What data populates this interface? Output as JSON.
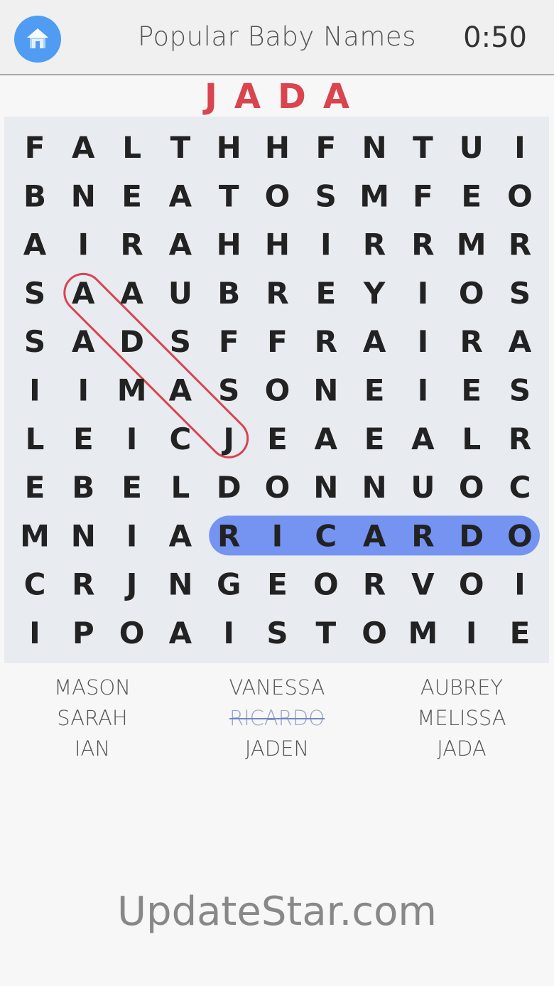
{
  "header": {
    "title": "Popular Baby Names",
    "timer": "0:50"
  },
  "current_word": "JADA",
  "grid": [
    [
      "F",
      "A",
      "L",
      "T",
      "H",
      "H",
      "F",
      "N",
      "T",
      "U",
      "I"
    ],
    [
      "B",
      "N",
      "E",
      "A",
      "T",
      "O",
      "S",
      "M",
      "F",
      "E",
      "O"
    ],
    [
      "A",
      "I",
      "R",
      "A",
      "H",
      "H",
      "I",
      "R",
      "R",
      "M",
      "R"
    ],
    [
      "S",
      "A",
      "A",
      "U",
      "B",
      "R",
      "E",
      "Y",
      "I",
      "O",
      "S"
    ],
    [
      "S",
      "A",
      "D",
      "S",
      "F",
      "F",
      "R",
      "A",
      "I",
      "R",
      "A"
    ],
    [
      "I",
      "I",
      "M",
      "A",
      "S",
      "O",
      "N",
      "E",
      "I",
      "E",
      "S"
    ],
    [
      "L",
      "E",
      "I",
      "C",
      "J",
      "E",
      "A",
      "E",
      "A",
      "L",
      "R"
    ],
    [
      "E",
      "B",
      "E",
      "L",
      "D",
      "O",
      "N",
      "N",
      "U",
      "O",
      "C"
    ],
    [
      "M",
      "N",
      "I",
      "A",
      "R",
      "I",
      "C",
      "A",
      "R",
      "D",
      "O"
    ],
    [
      "C",
      "R",
      "J",
      "N",
      "G",
      "E",
      "O",
      "R",
      "V",
      "O",
      "I"
    ],
    [
      "I",
      "P",
      "O",
      "A",
      "I",
      "S",
      "T",
      "O",
      "M",
      "I",
      "E"
    ]
  ],
  "selections": {
    "found": [
      {
        "word": "RICARDO",
        "start": [
          8,
          4
        ],
        "end": [
          8,
          10
        ],
        "color": "#6f8ff0"
      }
    ],
    "active": {
      "word": "JADA",
      "start": [
        3,
        1
      ],
      "end": [
        6,
        4
      ],
      "color": "#d9444f"
    }
  },
  "words": [
    {
      "label": "MASON",
      "found": false
    },
    {
      "label": "VANESSA",
      "found": false
    },
    {
      "label": "AUBREY",
      "found": false
    },
    {
      "label": "SARAH",
      "found": false
    },
    {
      "label": "RICARDO",
      "found": true
    },
    {
      "label": "MELISSA",
      "found": false
    },
    {
      "label": "IAN",
      "found": false
    },
    {
      "label": "JADEN",
      "found": false
    },
    {
      "label": "JADA",
      "found": false
    }
  ],
  "watermark": "UpdateStar.com",
  "colors": {
    "home_button": "#4f9cf2",
    "current_word": "#d9444f",
    "grid_background": "#e8ebf0"
  },
  "icons": {
    "home": "house-icon"
  }
}
